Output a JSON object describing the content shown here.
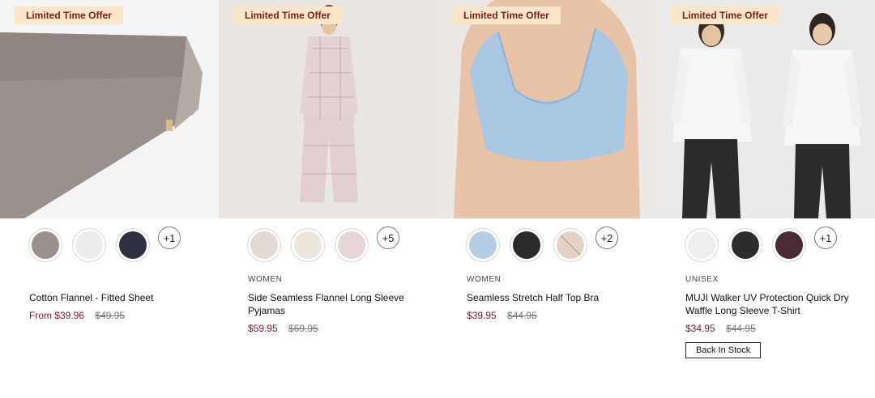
{
  "products": [
    {
      "badge": "Limited Time Offer",
      "category": "",
      "title": "Cotton Flannel - Fitted Sheet",
      "price": "From $39.96",
      "original_price": "$49.95",
      "more_swatches": "+1",
      "status": ""
    },
    {
      "badge": "Limited Time Offer",
      "category": "WOMEN",
      "title": "Side Seamless Flannel Long Sleeve Pyjamas",
      "price": "$59.95",
      "original_price": "$69.95",
      "more_swatches": "+5",
      "status": ""
    },
    {
      "badge": "Limited Time Offer",
      "category": "WOMEN",
      "title": "Seamless Stretch Half Top Bra",
      "price": "$39.95",
      "original_price": "$44.95",
      "more_swatches": "+2",
      "status": ""
    },
    {
      "badge": "Limited Time Offer",
      "category": "UNISEX",
      "title": "MUJI Walker UV Protection Quick Dry Waffle Long Sleeve T-Shirt",
      "price": "$34.95",
      "original_price": "$44.95",
      "more_swatches": "+1",
      "status": "Back In Stock"
    }
  ],
  "colors": {
    "badge_bg": "#fbe6c8",
    "badge_text": "#7a1f1f",
    "sale_price": "#7d1a2a"
  }
}
